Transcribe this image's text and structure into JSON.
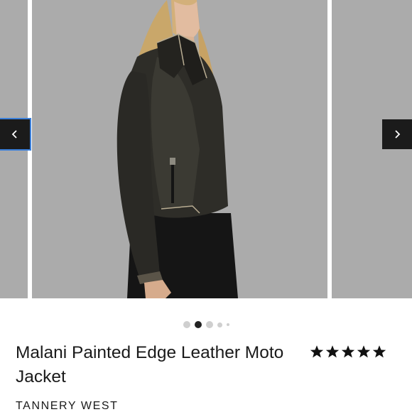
{
  "product": {
    "title": "Malani Painted Edge Leather Moto Jacket",
    "brand": "TANNERY WEST",
    "rating": 5,
    "rating_max": 5
  },
  "carousel": {
    "active_index": 1,
    "dot_count": 5,
    "prev_icon": "chevron-left-icon",
    "next_icon": "chevron-right-icon"
  },
  "colors": {
    "image_background": "#ababab",
    "nav_button": "#1b1b1b",
    "active_dot": "#222222",
    "inactive_dot": "#cfcfcf",
    "star": "#111111"
  }
}
